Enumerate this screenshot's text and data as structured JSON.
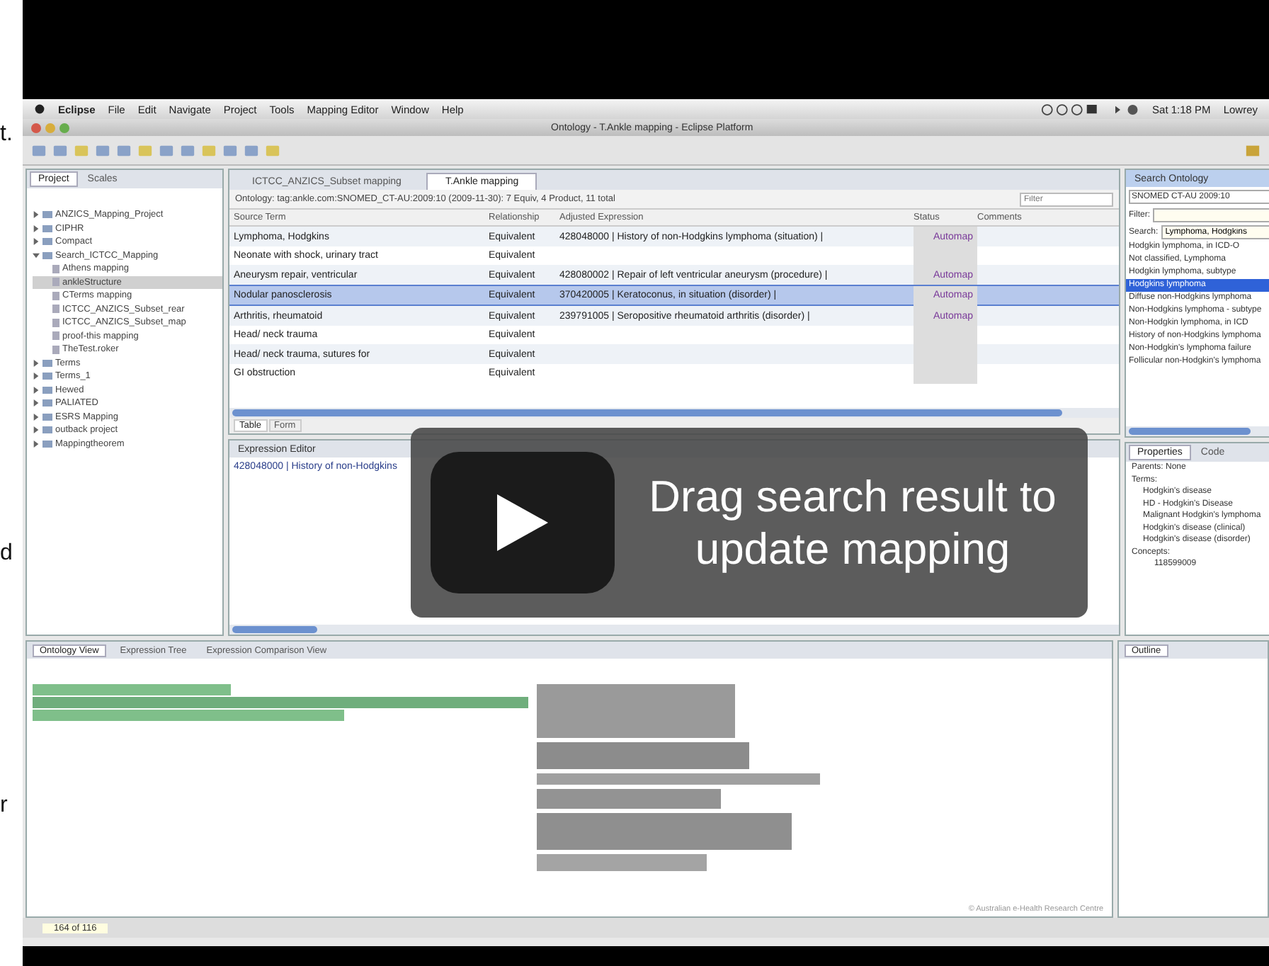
{
  "side_texts": [
    "t.",
    "d",
    "r"
  ],
  "menu_bar": {
    "items": [
      "Eclipse",
      "File",
      "Edit",
      "Navigate",
      "Project",
      "Tools",
      "Mapping Editor",
      "Window",
      "Help"
    ],
    "clock": "Sat 1:18 PM",
    "user": "Lowrey"
  },
  "window": {
    "title": "Ontology - T.Ankle mapping - Eclipse Platform"
  },
  "project_panel": {
    "tabs": [
      {
        "label": "Project",
        "selected": true
      },
      {
        "label": "Scales",
        "selected": false
      }
    ],
    "tree": [
      {
        "label": "ANZICS_Mapping_Project",
        "expanded": false,
        "selected": false
      },
      {
        "label": "CIPHR",
        "expanded": false,
        "selected": false
      },
      {
        "label": "Compact",
        "expanded": false,
        "selected": false
      },
      {
        "label": "Search_ICTCC_Mapping",
        "expanded": true,
        "selected": false,
        "children": [
          {
            "label": "Athens mapping",
            "selected": false
          },
          {
            "label": "ankleStructure",
            "selected": true
          },
          {
            "label": "CTerms mapping",
            "selected": false
          },
          {
            "label": "ICTCC_ANZICS_Subset_rear",
            "selected": false
          },
          {
            "label": "ICTCC_ANZICS_Subset_map",
            "selected": false
          },
          {
            "label": "proof-this mapping",
            "selected": false
          },
          {
            "label": "TheTest.roker",
            "selected": false
          }
        ]
      },
      {
        "label": "Terms",
        "expanded": false,
        "selected": false
      },
      {
        "label": "Terms_1",
        "expanded": false,
        "selected": false
      },
      {
        "label": "Hewed",
        "expanded": false,
        "selected": false
      },
      {
        "label": "PALIATED",
        "expanded": false,
        "selected": false
      },
      {
        "label": "ESRS Mapping",
        "expanded": false,
        "selected": false
      },
      {
        "label": "outback project",
        "expanded": false,
        "selected": false
      },
      {
        "label": "Mappingtheorem",
        "expanded": false,
        "selected": false
      }
    ]
  },
  "editor": {
    "tabs": [
      {
        "label": "ICTCC_ANZICS_Subset mapping",
        "selected": false
      },
      {
        "label": "T.Ankle mapping",
        "selected": true
      }
    ],
    "breadcrumb": "Ontology: tag:ankle.com:SNOMED_CT-AU:2009:10 (2009-11-30): 7 Equiv, 4 Product, 11 total",
    "filter_placeholder": "Filter",
    "table": {
      "columns": [
        "Source Term",
        "Relationship",
        "Adjusted Expression",
        "Status",
        "Comments"
      ],
      "rows": [
        {
          "cells": [
            "Lymphoma, Hodgkins",
            "Equivalent",
            "428048000 | History of non-Hodgkins lymphoma (situation) |",
            "Automap",
            ""
          ],
          "selected": false
        },
        {
          "cells": [
            "Neonate with shock, urinary tract",
            "Equivalent",
            "",
            "",
            ""
          ],
          "selected": false
        },
        {
          "cells": [
            "Aneurysm repair, ventricular",
            "Equivalent",
            "428080002 | Repair of left ventricular aneurysm (procedure) |",
            "Automap",
            ""
          ],
          "selected": false
        },
        {
          "cells": [
            "Nodular panosclerosis",
            "Equivalent",
            "370420005 | Keratoconus, in situation (disorder) |",
            "Automap",
            ""
          ],
          "selected": true
        },
        {
          "cells": [
            "Arthritis, rheumatoid",
            "Equivalent",
            "239791005 | Seropositive rheumatoid arthritis (disorder) |",
            "Automap",
            ""
          ],
          "selected": false
        },
        {
          "cells": [
            "Head/ neck trauma",
            "Equivalent",
            "",
            "",
            ""
          ],
          "selected": false
        },
        {
          "cells": [
            "Head/ neck trauma, sutures for",
            "Equivalent",
            "",
            "",
            ""
          ],
          "selected": false
        },
        {
          "cells": [
            "GI obstruction",
            "Equivalent",
            "",
            "",
            ""
          ],
          "selected": false
        }
      ]
    },
    "sub_tabs": [
      {
        "label": "Table",
        "selected": true
      },
      {
        "label": "Form",
        "selected": false
      }
    ],
    "expression_panel": {
      "title": "Expression Editor",
      "text": "428048000 | History of non-Hodgkins"
    }
  },
  "search_panel": {
    "title": "Search Ontology",
    "ontology": "SNOMED CT-AU 2009:10",
    "filter_label": "Filter:",
    "search_label": "Search:",
    "search_value": "Lymphoma, Hodgkins",
    "results": [
      {
        "label": "Hodgkin lymphoma, in ICD-O",
        "selected": false
      },
      {
        "label": "Not classified, Lymphoma",
        "selected": false
      },
      {
        "label": "Hodgkin lymphoma, subtype",
        "selected": false
      },
      {
        "label": "Hodgkins lymphoma",
        "selected": true
      },
      {
        "label": "Diffuse non-Hodgkins lymphoma",
        "selected": false
      },
      {
        "label": "Non-Hodgkins lymphoma - subtype",
        "selected": false
      },
      {
        "label": "Non-Hodgkin lymphoma, in ICD",
        "selected": false
      },
      {
        "label": "History of non-Hodgkins lymphoma",
        "selected": false
      },
      {
        "label": "Non-Hodgkin's lymphoma failure",
        "selected": false
      },
      {
        "label": "Follicular non-Hodgkin's lymphoma",
        "selected": false
      }
    ]
  },
  "properties_panel": {
    "tabs": [
      {
        "label": "Properties",
        "selected": true
      },
      {
        "label": "Code",
        "selected": false
      }
    ],
    "lines": [
      "Parents: None",
      "Terms:",
      "Hodgkin's disease",
      "HD - Hodgkin's Disease",
      "Malignant Hodgkin's lymphoma",
      "Hodgkin's disease (clinical)",
      "Hodgkin's disease (disorder)",
      "Concepts:",
      "118599009"
    ]
  },
  "bottom": {
    "tabs": [
      {
        "label": "Ontology View",
        "selected": true
      },
      {
        "label": "Expression Tree",
        "selected": false
      },
      {
        "label": "Expression Comparison View",
        "selected": false
      }
    ],
    "outline_title": "Outline",
    "credit": "© Australian e-Health Research Centre"
  },
  "status_bar": {
    "position": "164 of 116"
  },
  "video_overlay": {
    "title": "Drag search result to update mapping"
  }
}
